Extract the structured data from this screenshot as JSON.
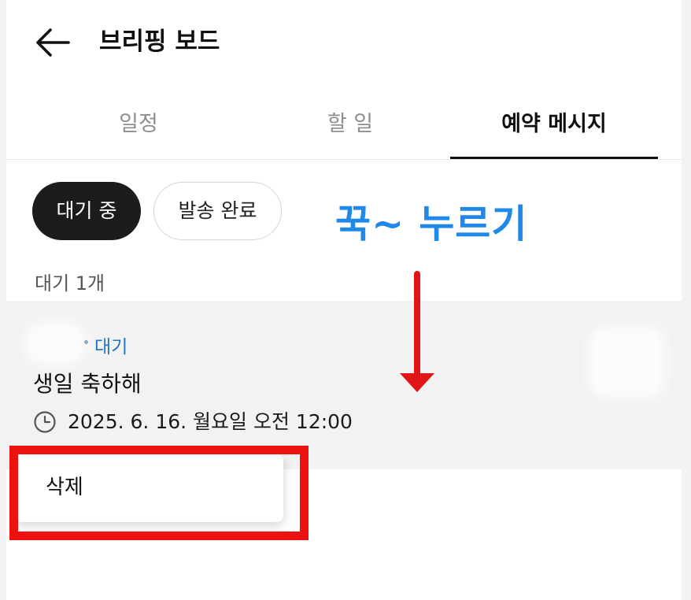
{
  "header": {
    "title": "브리핑 보드",
    "back_icon": "arrow-left-icon"
  },
  "tabs": [
    {
      "label": "일정",
      "selected": false
    },
    {
      "label": "할 일",
      "selected": false
    },
    {
      "label": "예약 메시지",
      "selected": true
    }
  ],
  "filters": {
    "active_label": "대기 중",
    "inactive_label": "발송 완료"
  },
  "list": {
    "count_label": "대기 1개",
    "items": [
      {
        "status": "대기",
        "message": "생일 축하해",
        "schedule_icon": "clock-icon",
        "datetime": "2025. 6. 16. 월요일 오전 12:00"
      }
    ]
  },
  "context_menu": {
    "delete_label": "삭제"
  },
  "annotation": {
    "text": "꾹~ 누르기",
    "arrow_icon": "arrow-down-icon"
  },
  "colors": {
    "accent_blue": "#1f88e8",
    "status_blue": "#1f74c7",
    "highlight_red": "#ee1111",
    "chip_active_bg": "#1c1c1c"
  }
}
